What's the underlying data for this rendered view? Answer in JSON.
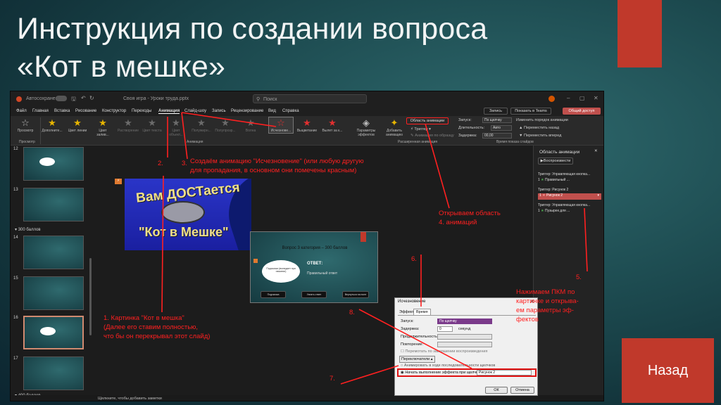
{
  "slide": {
    "title_line1": "Инструкция по создании вопроса",
    "title_line2": "«Кот в мешке»",
    "back_label": "Назад"
  },
  "app": {
    "autosave": "Автосохранение",
    "doc_title": "Своя игра - Уроки труда.pptx",
    "search_placeholder": "Поиск",
    "menu": [
      "Файл",
      "Главная",
      "Вставка",
      "Рисование",
      "Конструктор",
      "Переходы",
      "Анимация",
      "Слайд-шоу",
      "Запись",
      "Рецензирование",
      "Вид",
      "Справка"
    ],
    "active_menu": "Анимация",
    "record_btn": "Запись",
    "teams_btn": "Показать в Teams",
    "share_btn": "Общий доступ",
    "preview": "Просмотр",
    "effects": [
      "Дополните...",
      "Цвет линии",
      "Цвет залив...",
      "Растворение",
      "Цвет текста",
      "Цвет объект...",
      "Полужирн...",
      "Полупрозр...",
      "Волна",
      "Исчезнове...",
      "Выцветание",
      "Вылет за к..."
    ],
    "effect_params": "Параметры эффектов",
    "add_anim": "Добавить анимацию",
    "anim_pane_btn": "Область анимации",
    "trigger": "Триггер",
    "anim_painter": "Анимация по образцу",
    "start_label": "Запуск:",
    "start_val": "По щелчку",
    "duration_label": "Длительность:",
    "duration_val": "Авто",
    "delay_label": "Задержка:",
    "delay_val": "00,00",
    "reorder": "Изменить порядок анимации",
    "move_back": "Переместить назад",
    "move_fwd": "Переместить вперед",
    "group_preview": "Просмотр",
    "group_anim": "Анимация",
    "group_ext": "Расширенная анимация",
    "group_timing": "Время показа слайдов",
    "notes": "Щелкните, чтобы добавить заметки",
    "section_300": "300 баллов",
    "section_400": "400 баллов",
    "slide_nums": [
      "12",
      "13",
      "14",
      "15",
      "16",
      "17"
    ]
  },
  "anim_pane": {
    "title": "Область анимации",
    "play": "Воспроизвести",
    "items": [
      {
        "trigger": "Триггер: Управляющая кнопка...",
        "num": "1",
        "name": "Правильный ..."
      },
      {
        "trigger": "Триггер: Рисунок 2",
        "num": "1",
        "name": "Рисунок 2"
      },
      {
        "trigger": "Триггер: Управляющая кнопка...",
        "num": "1",
        "name": "Пузырек для ..."
      }
    ]
  },
  "canvas_slide": {
    "wordart_line1": "Вам ДОСТается",
    "wordart_line2": "\"Кот в Мешке\"",
    "q_title": "Вопрос 3 категория – 300 баллов",
    "answer_label": "ОТВЕТ:",
    "answer_text": "Правильный ответ",
    "cloud_text": "Подсказка (выпадает при нажатии)",
    "btn1": "Подсказка",
    "btn2": "Узнать ответ",
    "btn3": "Вернуться на поле"
  },
  "dialog": {
    "title": "Исчезновение",
    "tab_effect": "Эффект",
    "tab_time": "Время",
    "start_label": "Запуск:",
    "start_val": "По щелчку",
    "delay_label": "Задержка:",
    "delay_val": "0",
    "delay_unit": "секунд",
    "duration_label": "Продолжительность:",
    "repeat_label": "Повторение:",
    "rewind": "Перемотать по завершении воспроизведения",
    "switches": "Переключатели",
    "opt_sequence": "Анимировать в ходе последовательности щелчков",
    "opt_trigger": "Начать выполнение эффекта при щелчке",
    "trigger_val": "Рисунок 2",
    "ok": "ОК",
    "cancel": "Отмена"
  },
  "annotations": {
    "a1": "1. Картинка \"Кот в мешка\"\n(Далее его ставим полностью,\nчто бы он перекрывал этот слайд)",
    "a2": "2.",
    "a3": "3.",
    "a3_text": "Создаём анимацию \"Исчезновение\" (или любую другую\nдля пропадания, в основном они помечены красным)",
    "a4": "Открываем область\n4. анимаций",
    "a5": "5.",
    "a5_text": "Нажимаем ПКМ по\nкартинке и открыва-\nем параметры эф-\nфектов",
    "a6": "6.",
    "a7": "7.",
    "a8": "8."
  },
  "colors": {
    "accent_red": "#c0392b",
    "annotation_red": "#ff2020"
  }
}
